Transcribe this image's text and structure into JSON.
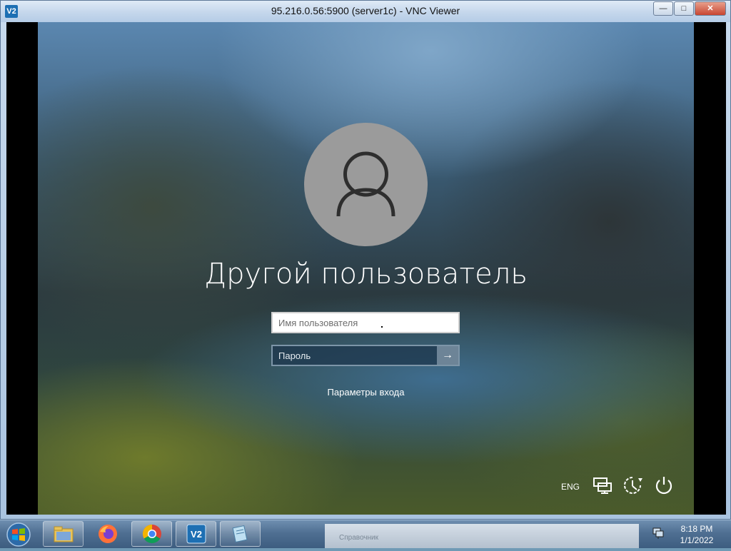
{
  "window": {
    "title": "95.216.0.56:5900 (server1c) - VNC Viewer",
    "icon": "vnc-viewer-icon",
    "icon_text": "V2",
    "controls": {
      "minimize": "—",
      "maximize": "□",
      "close": "✕"
    }
  },
  "login": {
    "avatar_icon": "user-avatar-icon",
    "user_name": "Другой пользователь",
    "username_placeholder": "Имя пользователя",
    "password_placeholder": "Пароль",
    "submit_icon": "arrow-right-icon",
    "submit_glyph": "→",
    "signin_options": "Параметры входа"
  },
  "lockscreen_tray": {
    "language": "ENG",
    "icons": [
      "network-icon",
      "accessibility-icon",
      "power-icon"
    ]
  },
  "taskbar": {
    "start": "windows-start-icon",
    "apps": [
      "file-explorer-icon",
      "firefox-icon",
      "chrome-icon",
      "vnc-viewer-icon",
      "notepad-icon"
    ],
    "ghost_text": "Справочник",
    "clock_time": "8:18 PM",
    "clock_date": "1/1/2022"
  },
  "colors": {
    "avatar_bg": "#9b9b9b",
    "password_bg": "#1e374e",
    "submit_bg": "#6d8497"
  }
}
